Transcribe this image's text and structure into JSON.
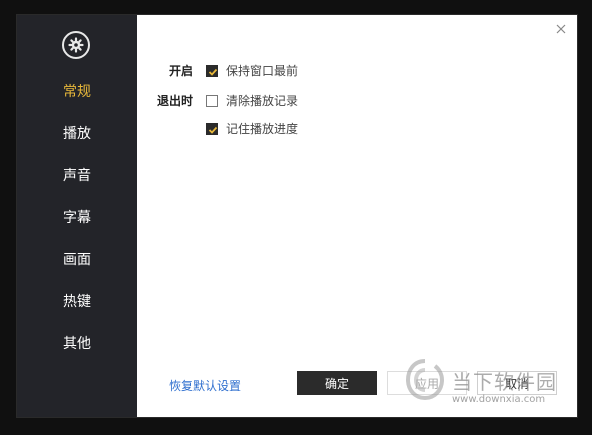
{
  "sidebar": {
    "icon": "gear-icon",
    "items": [
      {
        "label": "常规",
        "active": true
      },
      {
        "label": "播放"
      },
      {
        "label": "声音"
      },
      {
        "label": "字幕"
      },
      {
        "label": "画面"
      },
      {
        "label": "热键"
      },
      {
        "label": "其他"
      }
    ]
  },
  "general": {
    "startup_label": "开启",
    "exit_label": "退出时",
    "options": [
      {
        "label": "保持窗口最前",
        "checked": true
      },
      {
        "label": "清除播放记录",
        "checked": false
      },
      {
        "label": "记住播放进度",
        "checked": true
      }
    ]
  },
  "footer": {
    "restore_defaults": "恢复默认设置",
    "ok": "确定",
    "apply": "应用",
    "cancel": "取消"
  },
  "watermark": {
    "text": "当下软件园",
    "url": "www.downxia.com"
  },
  "colors": {
    "accent": "#e8b83a",
    "sidebar_bg": "#232429",
    "link": "#2f6fcf",
    "primary_button": "#2b2b2b"
  }
}
